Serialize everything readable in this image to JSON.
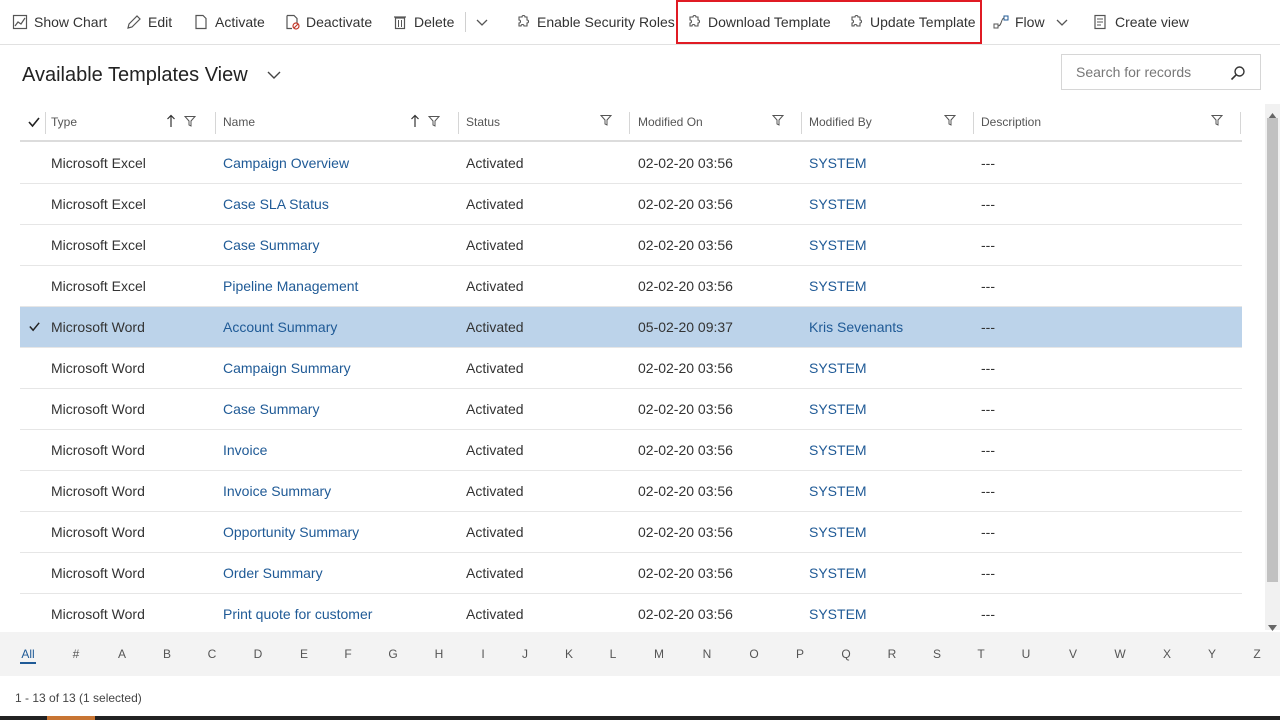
{
  "toolbar": {
    "show_chart": "Show Chart",
    "edit": "Edit",
    "activate": "Activate",
    "deactivate": "Deactivate",
    "delete": "Delete",
    "enable_security_roles": "Enable Security Roles",
    "download_template": "Download Template",
    "update_template": "Update Template",
    "flow": "Flow",
    "create_view": "Create view",
    "highlight_color": "#e01b24"
  },
  "view": {
    "title": "Available Templates View"
  },
  "search": {
    "placeholder": "Search for records"
  },
  "grid": {
    "columns": [
      "Type",
      "Name",
      "Status",
      "Modified On",
      "Modified By",
      "Description"
    ],
    "rows": [
      {
        "type": "Microsoft Excel",
        "name": "Campaign Overview",
        "status": "Activated",
        "modified_on": "02-02-20 03:56",
        "modified_by": "SYSTEM",
        "description": "---",
        "selected": false
      },
      {
        "type": "Microsoft Excel",
        "name": "Case SLA Status",
        "status": "Activated",
        "modified_on": "02-02-20 03:56",
        "modified_by": "SYSTEM",
        "description": "---",
        "selected": false
      },
      {
        "type": "Microsoft Excel",
        "name": "Case Summary",
        "status": "Activated",
        "modified_on": "02-02-20 03:56",
        "modified_by": "SYSTEM",
        "description": "---",
        "selected": false
      },
      {
        "type": "Microsoft Excel",
        "name": "Pipeline Management",
        "status": "Activated",
        "modified_on": "02-02-20 03:56",
        "modified_by": "SYSTEM",
        "description": "---",
        "selected": false
      },
      {
        "type": "Microsoft Word",
        "name": "Account Summary",
        "status": "Activated",
        "modified_on": "05-02-20 09:37",
        "modified_by": "Kris Sevenants",
        "description": "---",
        "selected": true
      },
      {
        "type": "Microsoft Word",
        "name": "Campaign Summary",
        "status": "Activated",
        "modified_on": "02-02-20 03:56",
        "modified_by": "SYSTEM",
        "description": "---",
        "selected": false
      },
      {
        "type": "Microsoft Word",
        "name": "Case Summary",
        "status": "Activated",
        "modified_on": "02-02-20 03:56",
        "modified_by": "SYSTEM",
        "description": "---",
        "selected": false
      },
      {
        "type": "Microsoft Word",
        "name": "Invoice",
        "status": "Activated",
        "modified_on": "02-02-20 03:56",
        "modified_by": "SYSTEM",
        "description": "---",
        "selected": false
      },
      {
        "type": "Microsoft Word",
        "name": "Invoice Summary",
        "status": "Activated",
        "modified_on": "02-02-20 03:56",
        "modified_by": "SYSTEM",
        "description": "---",
        "selected": false
      },
      {
        "type": "Microsoft Word",
        "name": "Opportunity Summary",
        "status": "Activated",
        "modified_on": "02-02-20 03:56",
        "modified_by": "SYSTEM",
        "description": "---",
        "selected": false
      },
      {
        "type": "Microsoft Word",
        "name": "Order Summary",
        "status": "Activated",
        "modified_on": "02-02-20 03:56",
        "modified_by": "SYSTEM",
        "description": "---",
        "selected": false
      },
      {
        "type": "Microsoft Word",
        "name": "Print quote for customer",
        "status": "Activated",
        "modified_on": "02-02-20 03:56",
        "modified_by": "SYSTEM",
        "description": "---",
        "selected": false
      }
    ],
    "selected_color": "#bcd3ea",
    "link_color": "#1f5a96"
  },
  "alphabet": [
    "All",
    "#",
    "A",
    "B",
    "C",
    "D",
    "E",
    "F",
    "G",
    "H",
    "I",
    "J",
    "K",
    "L",
    "M",
    "N",
    "O",
    "P",
    "Q",
    "R",
    "S",
    "T",
    "U",
    "V",
    "W",
    "X",
    "Y",
    "Z"
  ],
  "footer": {
    "status": "1 - 13 of 13 (1 selected)"
  }
}
